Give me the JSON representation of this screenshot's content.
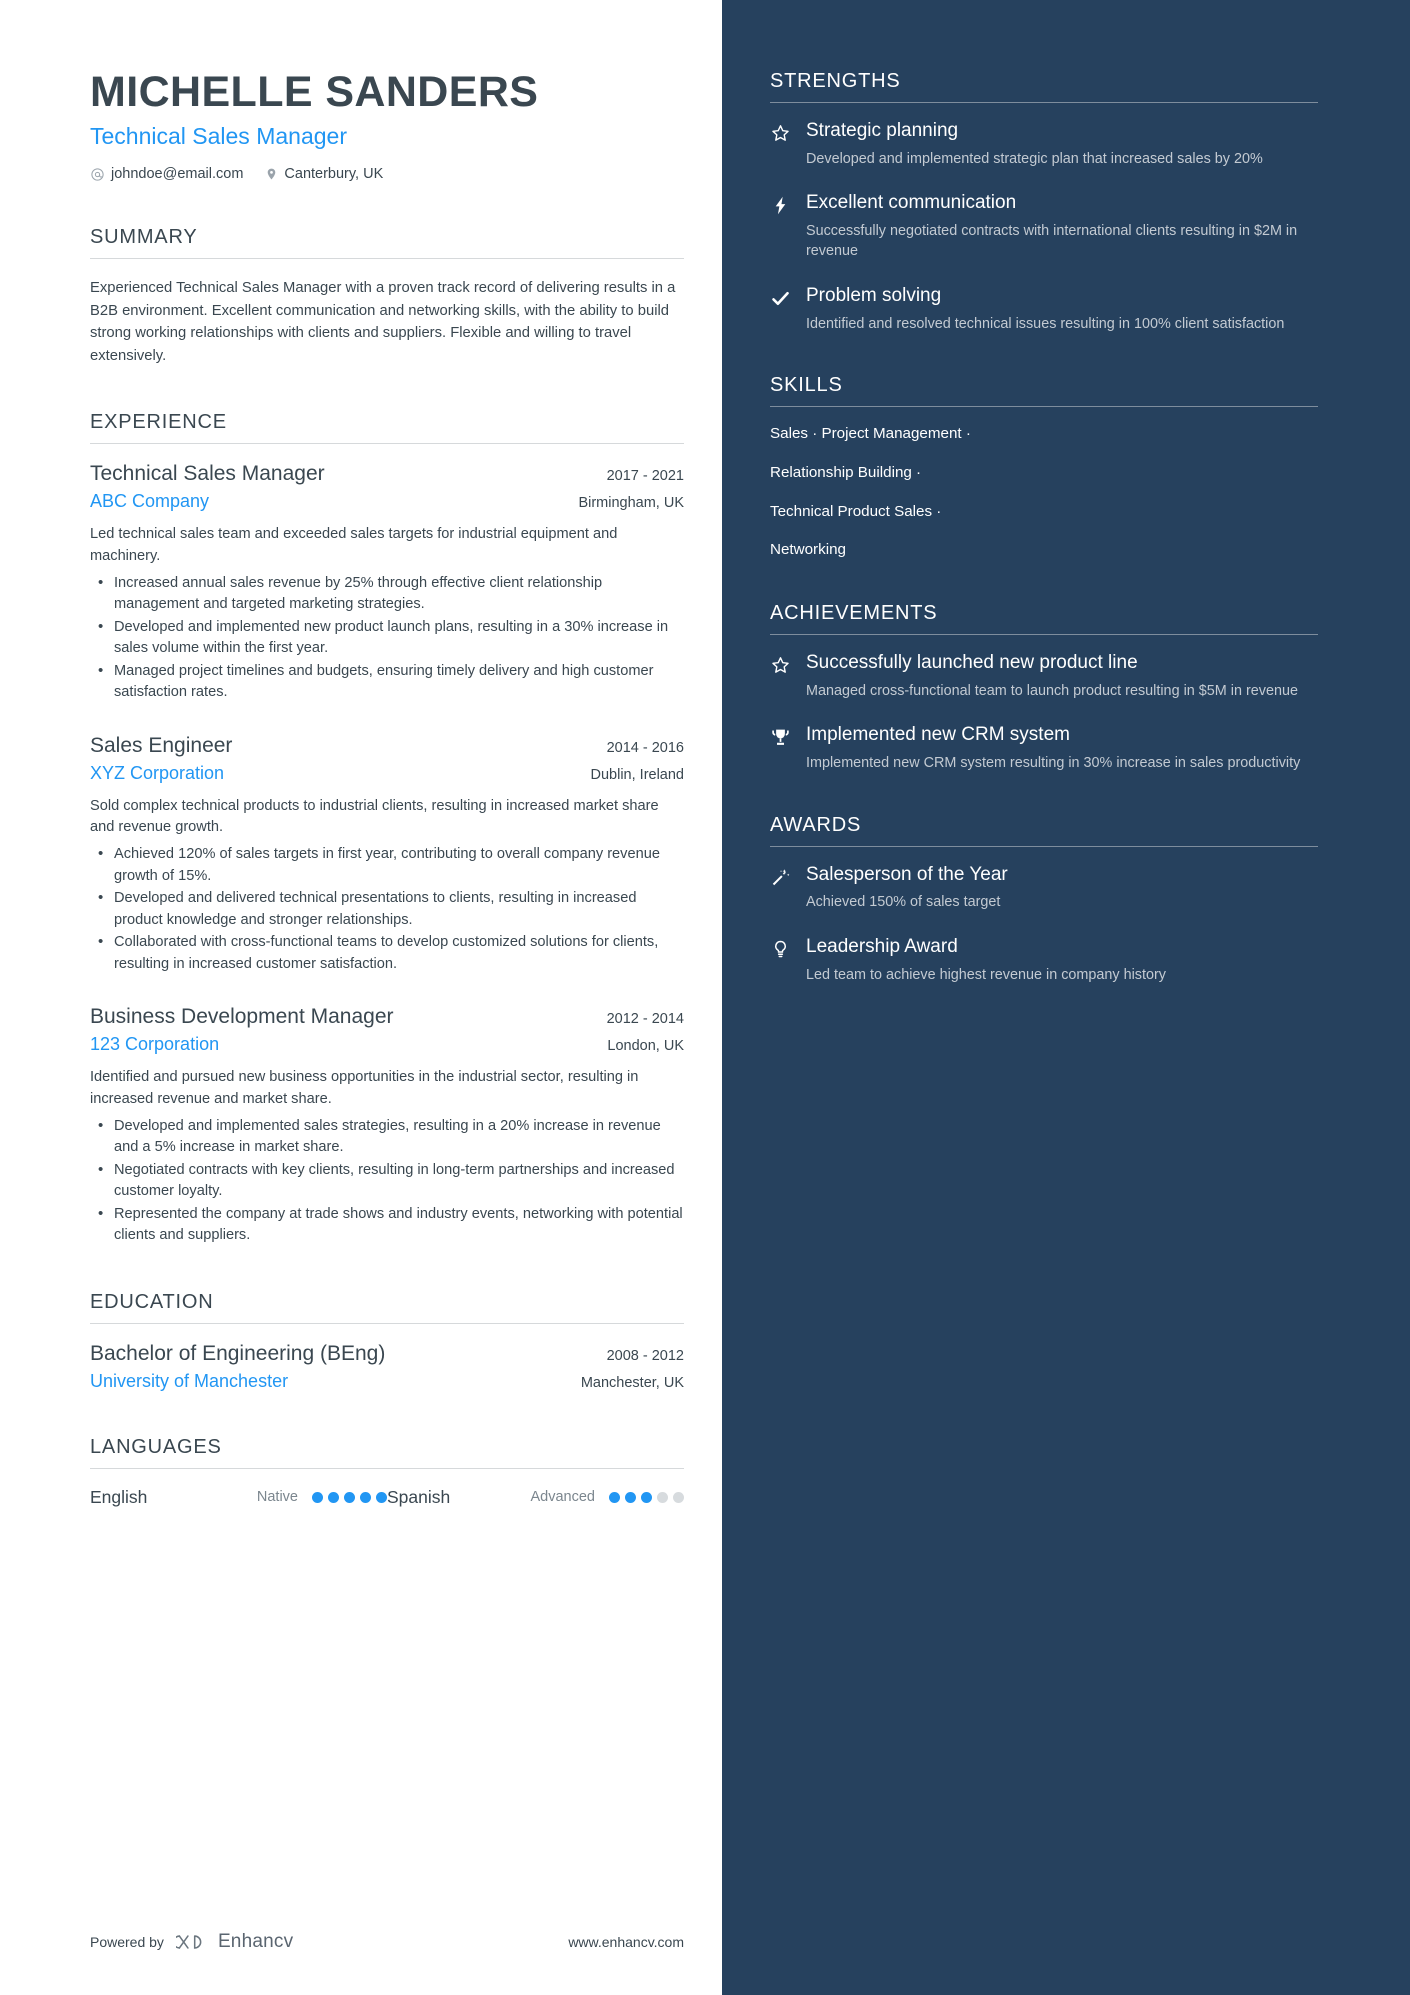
{
  "header": {
    "name": "MICHELLE SANDERS",
    "role": "Technical Sales Manager",
    "email": "johndoe@email.com",
    "location": "Canterbury, UK"
  },
  "summary": {
    "title": "SUMMARY",
    "text": "Experienced Technical Sales Manager with a proven track record of delivering results in a B2B environment. Excellent communication and networking skills, with the ability to build strong working relationships with clients and suppliers. Flexible and willing to travel extensively."
  },
  "experience": {
    "title": "EXPERIENCE",
    "entries": [
      {
        "title": "Technical Sales Manager",
        "dates": "2017 - 2021",
        "org": "ABC Company",
        "location": "Birmingham, UK",
        "desc": "Led technical sales team and exceeded sales targets for industrial equipment and machinery.",
        "bullets": [
          "Increased annual sales revenue by 25% through effective client relationship management and targeted marketing strategies.",
          "Developed and implemented new product launch plans, resulting in a 30% increase in sales volume within the first year.",
          "Managed project timelines and budgets, ensuring timely delivery and high customer satisfaction rates."
        ]
      },
      {
        "title": "Sales Engineer",
        "dates": "2014 - 2016",
        "org": "XYZ Corporation",
        "location": "Dublin, Ireland",
        "desc": "Sold complex technical products to industrial clients, resulting in increased market share and revenue growth.",
        "bullets": [
          "Achieved 120% of sales targets in first year, contributing to overall company revenue growth of 15%.",
          "Developed and delivered technical presentations to clients, resulting in increased product knowledge and stronger relationships.",
          "Collaborated with cross-functional teams to develop customized solutions for clients, resulting in increased customer satisfaction."
        ]
      },
      {
        "title": "Business Development Manager",
        "dates": "2012 - 2014",
        "org": "123 Corporation",
        "location": "London, UK",
        "desc": "Identified and pursued new business opportunities in the industrial sector, resulting in increased revenue and market share.",
        "bullets": [
          "Developed and implemented sales strategies, resulting in a 20% increase in revenue and a 5% increase in market share.",
          "Negotiated contracts with key clients, resulting in long-term partnerships and increased customer loyalty.",
          "Represented the company at trade shows and industry events, networking with potential clients and suppliers."
        ]
      }
    ]
  },
  "education": {
    "title": "EDUCATION",
    "entries": [
      {
        "title": "Bachelor of Engineering (BEng)",
        "dates": "2008 - 2012",
        "org": "University of Manchester",
        "location": "Manchester, UK"
      }
    ]
  },
  "languages": {
    "title": "LANGUAGES",
    "items": [
      {
        "name": "English",
        "level": "Native",
        "filled": 5,
        "total": 5
      },
      {
        "name": "Spanish",
        "level": "Advanced",
        "filled": 3,
        "total": 5
      }
    ]
  },
  "footer": {
    "powered_by": "Powered by",
    "brand": "Enhancv",
    "website": "www.enhancv.com"
  },
  "strengths": {
    "title": "STRENGTHS",
    "items": [
      {
        "icon": "star-icon",
        "title": "Strategic planning",
        "desc": "Developed and implemented strategic plan that increased sales by 20%"
      },
      {
        "icon": "lightning-icon",
        "title": "Excellent communication",
        "desc": "Successfully negotiated contracts with international clients resulting in $2M in revenue"
      },
      {
        "icon": "check-icon",
        "title": "Problem solving",
        "desc": "Identified and resolved technical issues resulting in 100% client satisfaction"
      }
    ]
  },
  "skills": {
    "title": "SKILLS",
    "lines": [
      "Sales · Project Management ·",
      "Relationship Building ·",
      "Technical Product Sales ·",
      "Networking"
    ]
  },
  "achievements": {
    "title": "ACHIEVEMENTS",
    "items": [
      {
        "icon": "star-icon",
        "title": "Successfully launched new product line",
        "desc": "Managed cross-functional team to launch product resulting in $5M in revenue"
      },
      {
        "icon": "trophy-icon",
        "title": "Implemented new CRM system",
        "desc": "Implemented new CRM system resulting in 30% increase in sales productivity"
      }
    ]
  },
  "awards": {
    "title": "AWARDS",
    "items": [
      {
        "icon": "magic-wand-icon",
        "title": "Salesperson of the Year",
        "desc": "Achieved 150% of sales target"
      },
      {
        "icon": "lightbulb-icon",
        "title": "Leadership Award",
        "desc": "Led team to achieve highest revenue in company history"
      }
    ]
  },
  "colors": {
    "accent": "#2196f3",
    "sidebar_bg": "#26415e",
    "text": "#3a4750"
  }
}
